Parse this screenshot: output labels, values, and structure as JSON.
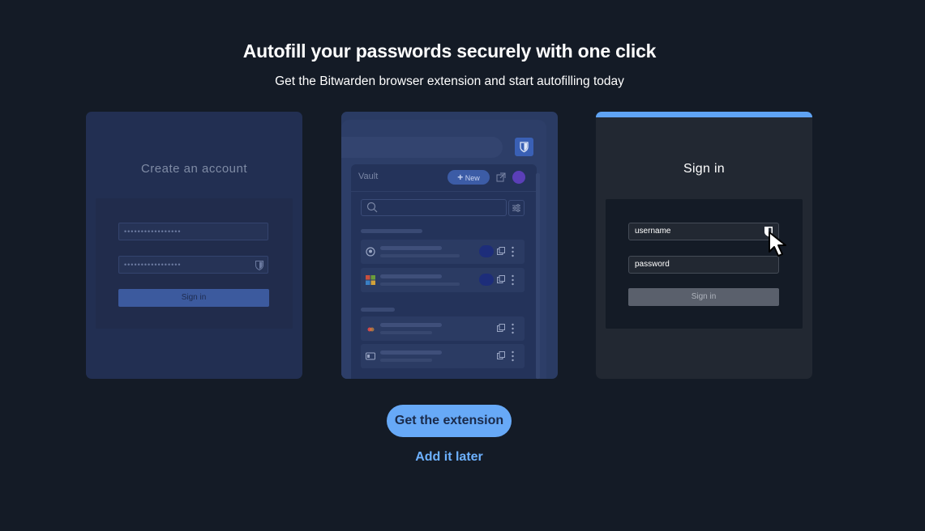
{
  "header": {
    "title": "Autofill your passwords securely with one click",
    "subtitle": "Get the Bitwarden browser extension and start autofilling today"
  },
  "card_create": {
    "heading": "Create an account",
    "field1_dots": "•••••••••••••••••",
    "field2_dots": "•••••••••••••••••",
    "button_label": "Sign in"
  },
  "card_extension": {
    "vault_label": "Vault",
    "new_button_label": "New",
    "new_button_icon": "plus-icon",
    "items": [
      {
        "icon": "github-icon"
      },
      {
        "icon": "microsoft-icon"
      },
      {
        "icon": "card-icon"
      },
      {
        "icon": "id-card-icon"
      }
    ]
  },
  "card_signin": {
    "heading": "Sign in",
    "username_value": "username",
    "password_value": "password",
    "button_label": "Sign in"
  },
  "actions": {
    "primary_label": "Get the extension",
    "secondary_label": "Add it later"
  },
  "colors": {
    "background": "#141b26",
    "accent": "#67a9f7",
    "link": "#6db1ff"
  }
}
